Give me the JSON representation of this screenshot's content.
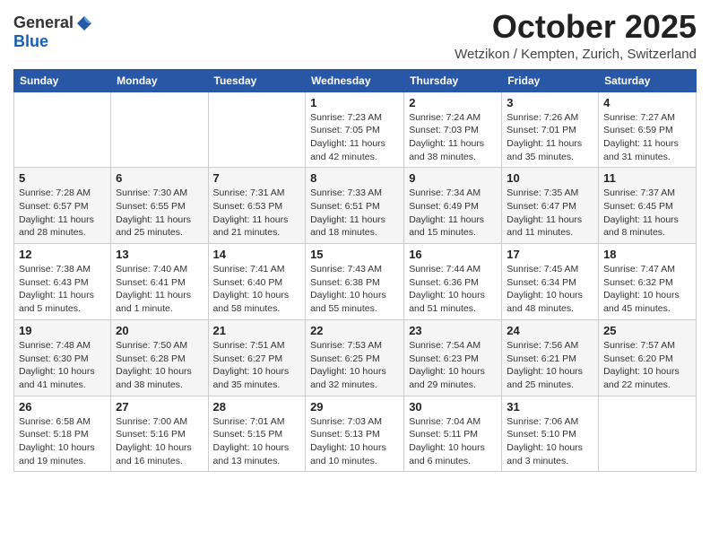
{
  "logo": {
    "general": "General",
    "blue": "Blue"
  },
  "header": {
    "month": "October 2025",
    "location": "Wetzikon / Kempten, Zurich, Switzerland"
  },
  "days_of_week": [
    "Sunday",
    "Monday",
    "Tuesday",
    "Wednesday",
    "Thursday",
    "Friday",
    "Saturday"
  ],
  "weeks": [
    [
      {
        "day": "",
        "info": ""
      },
      {
        "day": "",
        "info": ""
      },
      {
        "day": "",
        "info": ""
      },
      {
        "day": "1",
        "info": "Sunrise: 7:23 AM\nSunset: 7:05 PM\nDaylight: 11 hours\nand 42 minutes."
      },
      {
        "day": "2",
        "info": "Sunrise: 7:24 AM\nSunset: 7:03 PM\nDaylight: 11 hours\nand 38 minutes."
      },
      {
        "day": "3",
        "info": "Sunrise: 7:26 AM\nSunset: 7:01 PM\nDaylight: 11 hours\nand 35 minutes."
      },
      {
        "day": "4",
        "info": "Sunrise: 7:27 AM\nSunset: 6:59 PM\nDaylight: 11 hours\nand 31 minutes."
      }
    ],
    [
      {
        "day": "5",
        "info": "Sunrise: 7:28 AM\nSunset: 6:57 PM\nDaylight: 11 hours\nand 28 minutes."
      },
      {
        "day": "6",
        "info": "Sunrise: 7:30 AM\nSunset: 6:55 PM\nDaylight: 11 hours\nand 25 minutes."
      },
      {
        "day": "7",
        "info": "Sunrise: 7:31 AM\nSunset: 6:53 PM\nDaylight: 11 hours\nand 21 minutes."
      },
      {
        "day": "8",
        "info": "Sunrise: 7:33 AM\nSunset: 6:51 PM\nDaylight: 11 hours\nand 18 minutes."
      },
      {
        "day": "9",
        "info": "Sunrise: 7:34 AM\nSunset: 6:49 PM\nDaylight: 11 hours\nand 15 minutes."
      },
      {
        "day": "10",
        "info": "Sunrise: 7:35 AM\nSunset: 6:47 PM\nDaylight: 11 hours\nand 11 minutes."
      },
      {
        "day": "11",
        "info": "Sunrise: 7:37 AM\nSunset: 6:45 PM\nDaylight: 11 hours\nand 8 minutes."
      }
    ],
    [
      {
        "day": "12",
        "info": "Sunrise: 7:38 AM\nSunset: 6:43 PM\nDaylight: 11 hours\nand 5 minutes."
      },
      {
        "day": "13",
        "info": "Sunrise: 7:40 AM\nSunset: 6:41 PM\nDaylight: 11 hours\nand 1 minute."
      },
      {
        "day": "14",
        "info": "Sunrise: 7:41 AM\nSunset: 6:40 PM\nDaylight: 10 hours\nand 58 minutes."
      },
      {
        "day": "15",
        "info": "Sunrise: 7:43 AM\nSunset: 6:38 PM\nDaylight: 10 hours\nand 55 minutes."
      },
      {
        "day": "16",
        "info": "Sunrise: 7:44 AM\nSunset: 6:36 PM\nDaylight: 10 hours\nand 51 minutes."
      },
      {
        "day": "17",
        "info": "Sunrise: 7:45 AM\nSunset: 6:34 PM\nDaylight: 10 hours\nand 48 minutes."
      },
      {
        "day": "18",
        "info": "Sunrise: 7:47 AM\nSunset: 6:32 PM\nDaylight: 10 hours\nand 45 minutes."
      }
    ],
    [
      {
        "day": "19",
        "info": "Sunrise: 7:48 AM\nSunset: 6:30 PM\nDaylight: 10 hours\nand 41 minutes."
      },
      {
        "day": "20",
        "info": "Sunrise: 7:50 AM\nSunset: 6:28 PM\nDaylight: 10 hours\nand 38 minutes."
      },
      {
        "day": "21",
        "info": "Sunrise: 7:51 AM\nSunset: 6:27 PM\nDaylight: 10 hours\nand 35 minutes."
      },
      {
        "day": "22",
        "info": "Sunrise: 7:53 AM\nSunset: 6:25 PM\nDaylight: 10 hours\nand 32 minutes."
      },
      {
        "day": "23",
        "info": "Sunrise: 7:54 AM\nSunset: 6:23 PM\nDaylight: 10 hours\nand 29 minutes."
      },
      {
        "day": "24",
        "info": "Sunrise: 7:56 AM\nSunset: 6:21 PM\nDaylight: 10 hours\nand 25 minutes."
      },
      {
        "day": "25",
        "info": "Sunrise: 7:57 AM\nSunset: 6:20 PM\nDaylight: 10 hours\nand 22 minutes."
      }
    ],
    [
      {
        "day": "26",
        "info": "Sunrise: 6:58 AM\nSunset: 5:18 PM\nDaylight: 10 hours\nand 19 minutes."
      },
      {
        "day": "27",
        "info": "Sunrise: 7:00 AM\nSunset: 5:16 PM\nDaylight: 10 hours\nand 16 minutes."
      },
      {
        "day": "28",
        "info": "Sunrise: 7:01 AM\nSunset: 5:15 PM\nDaylight: 10 hours\nand 13 minutes."
      },
      {
        "day": "29",
        "info": "Sunrise: 7:03 AM\nSunset: 5:13 PM\nDaylight: 10 hours\nand 10 minutes."
      },
      {
        "day": "30",
        "info": "Sunrise: 7:04 AM\nSunset: 5:11 PM\nDaylight: 10 hours\nand 6 minutes."
      },
      {
        "day": "31",
        "info": "Sunrise: 7:06 AM\nSunset: 5:10 PM\nDaylight: 10 hours\nand 3 minutes."
      },
      {
        "day": "",
        "info": ""
      }
    ]
  ]
}
